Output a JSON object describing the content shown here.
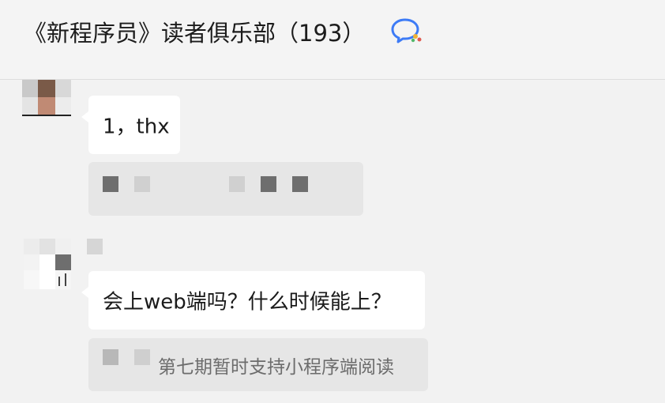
{
  "header": {
    "title": "《新程序员》读者俱乐部（193）",
    "icon": "chat-bubble-icon"
  },
  "messages": [
    {
      "text": "1，thx",
      "quote_text": ""
    },
    {
      "text": "会上web端吗？什么时候能上？",
      "quote_text": "第七期暂时支持小程序端阅读"
    }
  ],
  "colors": {
    "background": "#f2f2f2",
    "bubble": "#ffffff",
    "quote": "#e6e6e6",
    "icon_blue": "#3d7bf6"
  }
}
